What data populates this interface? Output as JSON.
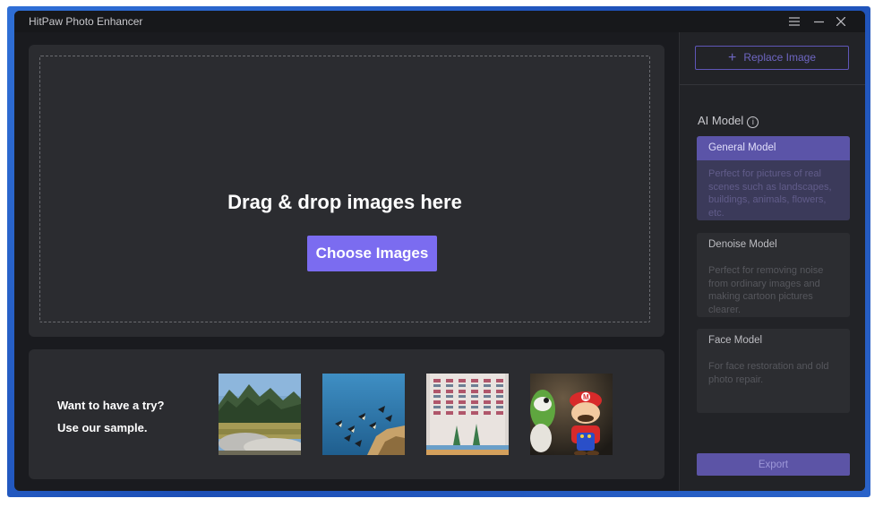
{
  "window": {
    "title": "HitPaw Photo Enhancer",
    "controls": [
      "menu-icon",
      "minimize-icon",
      "close-icon"
    ]
  },
  "drop_zone": {
    "title": "Drag & drop images here",
    "choose_label": "Choose Images"
  },
  "samples": {
    "line1": "Want to have a try?",
    "line2": "Use our sample.",
    "thumbnails": [
      "landscape",
      "fish",
      "building",
      "toys"
    ]
  },
  "sidebar": {
    "replace_label": "Replace Image",
    "ai_model_label": "AI Model",
    "models": [
      {
        "name": "General Model",
        "description": "Perfect for pictures of real scenes such as landscapes, buildings, animals, flowers, etc.",
        "selected": true
      },
      {
        "name": "Denoise Model",
        "description": "Perfect for removing noise from ordinary images and making cartoon pictures clearer.",
        "selected": false
      },
      {
        "name": "Face Model",
        "description": "For face restoration and old photo repair.",
        "selected": false
      }
    ],
    "export_label": "Export"
  },
  "colors": {
    "accent": "#7b6cf0",
    "panel": "#2b2c30",
    "window_bg": "#1a1b1f"
  }
}
